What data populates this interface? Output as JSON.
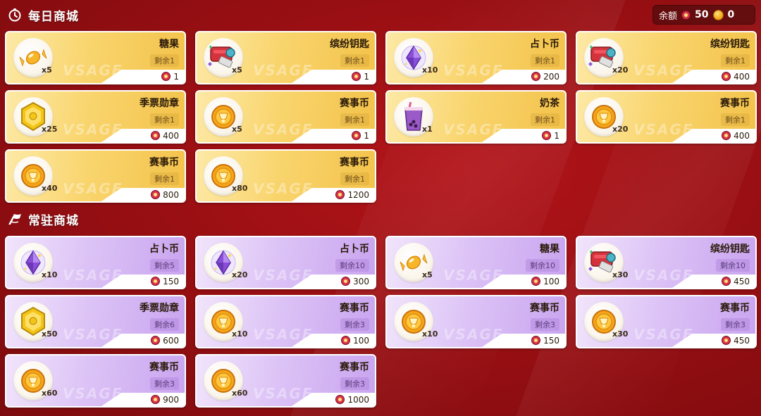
{
  "daily_title": "每日商城",
  "permanent_title": "常驻商城",
  "balance": {
    "label": "余额",
    "flower_amount": "50",
    "coin_amount": "0",
    "flower_icon": "flower-currency-icon",
    "coin_icon": "gold-coin-icon"
  },
  "colors": {
    "background": "#9a0f13",
    "daily_card": "#f9d56e",
    "permanent_card": "#dcc3f6"
  },
  "daily_items": [
    {
      "name": "糖果",
      "qty": "x5",
      "remain": "剩余1",
      "price": "1",
      "icon": "candy-icon"
    },
    {
      "name": "缤纷钥匙",
      "qty": "x5",
      "remain": "剩余1",
      "price": "1",
      "icon": "key-icon"
    },
    {
      "name": "占卜币",
      "qty": "x10",
      "remain": "剩余1",
      "price": "200",
      "icon": "crystal-icon"
    },
    {
      "name": "缤纷钥匙",
      "qty": "x20",
      "remain": "剩余1",
      "price": "400",
      "icon": "key-icon"
    },
    {
      "name": "季票勋章",
      "qty": "x25",
      "remain": "剩余1",
      "price": "400",
      "icon": "medal-icon"
    },
    {
      "name": "赛事币",
      "qty": "x5",
      "remain": "剩余1",
      "price": "1",
      "icon": "coin-icon"
    },
    {
      "name": "奶茶",
      "qty": "x1",
      "remain": "剩余1",
      "price": "1",
      "icon": "milk-tea-icon"
    },
    {
      "name": "赛事币",
      "qty": "x20",
      "remain": "剩余1",
      "price": "400",
      "icon": "coin-icon"
    },
    {
      "name": "赛事币",
      "qty": "x40",
      "remain": "剩余1",
      "price": "800",
      "icon": "coin-icon"
    },
    {
      "name": "赛事币",
      "qty": "x80",
      "remain": "剩余1",
      "price": "1200",
      "icon": "coin-icon"
    }
  ],
  "permanent_items": [
    {
      "name": "占卜币",
      "qty": "x10",
      "remain": "剩余5",
      "price": "150",
      "icon": "crystal-icon"
    },
    {
      "name": "占卜币",
      "qty": "x20",
      "remain": "剩余10",
      "price": "300",
      "icon": "crystal-icon"
    },
    {
      "name": "糖果",
      "qty": "x5",
      "remain": "剩余10",
      "price": "100",
      "icon": "candy-icon"
    },
    {
      "name": "缤纷钥匙",
      "qty": "x30",
      "remain": "剩余10",
      "price": "450",
      "icon": "key-icon"
    },
    {
      "name": "季票勋章",
      "qty": "x50",
      "remain": "剩余6",
      "price": "600",
      "icon": "medal-icon"
    },
    {
      "name": "赛事币",
      "qty": "x10",
      "remain": "剩余3",
      "price": "100",
      "icon": "coin-icon"
    },
    {
      "name": "赛事币",
      "qty": "x10",
      "remain": "剩余3",
      "price": "150",
      "icon": "coin-icon"
    },
    {
      "name": "赛事币",
      "qty": "x30",
      "remain": "剩余3",
      "price": "450",
      "icon": "coin-icon"
    },
    {
      "name": "赛事币",
      "qty": "x60",
      "remain": "剩余3",
      "price": "900",
      "icon": "coin-icon"
    },
    {
      "name": "赛事币",
      "qty": "x60",
      "remain": "剩余3",
      "price": "1000",
      "icon": "coin-icon"
    }
  ]
}
